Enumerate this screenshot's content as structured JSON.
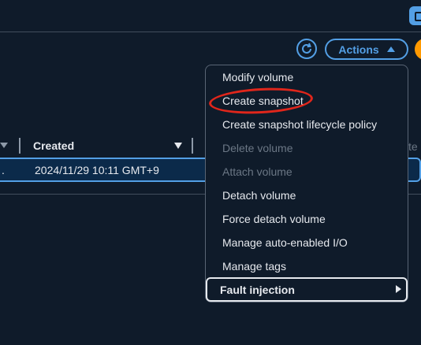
{
  "toolbar": {
    "refresh_icon": "refresh-icon",
    "actions_label": "Actions",
    "actions_caret_icon": "caret-up-icon"
  },
  "table": {
    "columns": [
      {
        "label": "Created"
      }
    ],
    "hidden_column_fragment": "te",
    "rows": [
      {
        "truncated": ".",
        "created": "2024/11/29 10:11 GMT+9"
      }
    ]
  },
  "menu": {
    "items": [
      {
        "label": "Modify volume",
        "enabled": true
      },
      {
        "label": "Create snapshot",
        "enabled": true,
        "highlighted": true
      },
      {
        "label": "Create snapshot lifecycle policy",
        "enabled": true
      },
      {
        "label": "Delete volume",
        "enabled": false
      },
      {
        "label": "Attach volume",
        "enabled": false
      },
      {
        "label": "Detach volume",
        "enabled": true
      },
      {
        "label": "Force detach volume",
        "enabled": true
      },
      {
        "label": "Manage auto-enabled I/O",
        "enabled": true
      },
      {
        "label": "Manage tags",
        "enabled": true
      }
    ],
    "submenu": {
      "label": "Fault injection",
      "icon": "chevron-right-icon"
    }
  },
  "colors": {
    "background": "#0f1b2a",
    "accent": "#539fe5",
    "orange": "#ff9900",
    "highlight_ring": "#e0261b",
    "disabled_text": "#6b7785"
  }
}
